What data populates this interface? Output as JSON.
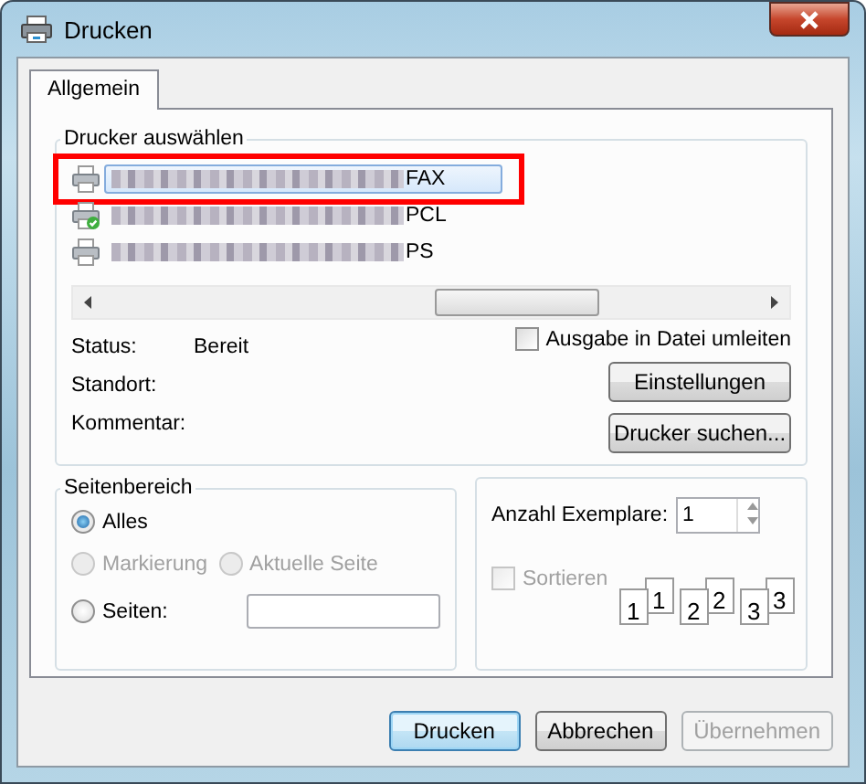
{
  "window": {
    "title": "Drucken"
  },
  "tabs": [
    {
      "label": "Allgemein",
      "selected": true
    }
  ],
  "printer_group": {
    "title": "Drucker auswählen",
    "printers": [
      {
        "name": "FAX",
        "selected": true,
        "highlighted": true,
        "default": false
      },
      {
        "name": "PCL",
        "selected": false,
        "highlighted": false,
        "default": true
      },
      {
        "name": "PS",
        "selected": false,
        "highlighted": false,
        "default": false
      }
    ],
    "status_label": "Status:",
    "status": "Bereit",
    "location_label": "Standort:",
    "comment_label": "Kommentar:",
    "print_to_file": {
      "label": "Ausgabe in Datei umleiten",
      "checked": false
    },
    "buttons": [
      {
        "label": "Einstellungen"
      },
      {
        "label": "Drucker suchen..."
      }
    ]
  },
  "page_range": {
    "title": "Seitenbereich",
    "options": [
      {
        "label": "Alles",
        "selected": true,
        "disabled": false
      },
      {
        "label": "Markierung",
        "selected": false,
        "disabled": true
      },
      {
        "label": "Aktuelle Seite",
        "selected": false,
        "disabled": true
      },
      {
        "label": "Seiten:",
        "selected": false,
        "disabled": false
      }
    ]
  },
  "copies": {
    "label": "Anzahl Exemplare:",
    "value": "1",
    "collate": {
      "label": "Sortieren",
      "checked": false,
      "disabled": true
    },
    "pages": [
      {
        "back": "1",
        "front": "1"
      },
      {
        "back": "2",
        "front": "2"
      },
      {
        "back": "3",
        "front": "3"
      }
    ]
  },
  "buttons": [
    {
      "label": "Drucken",
      "default": true,
      "disabled": false
    },
    {
      "label": "Abbrechen",
      "default": false,
      "disabled": false
    },
    {
      "label": "Übernehmen",
      "default": false,
      "disabled": true
    }
  ]
}
